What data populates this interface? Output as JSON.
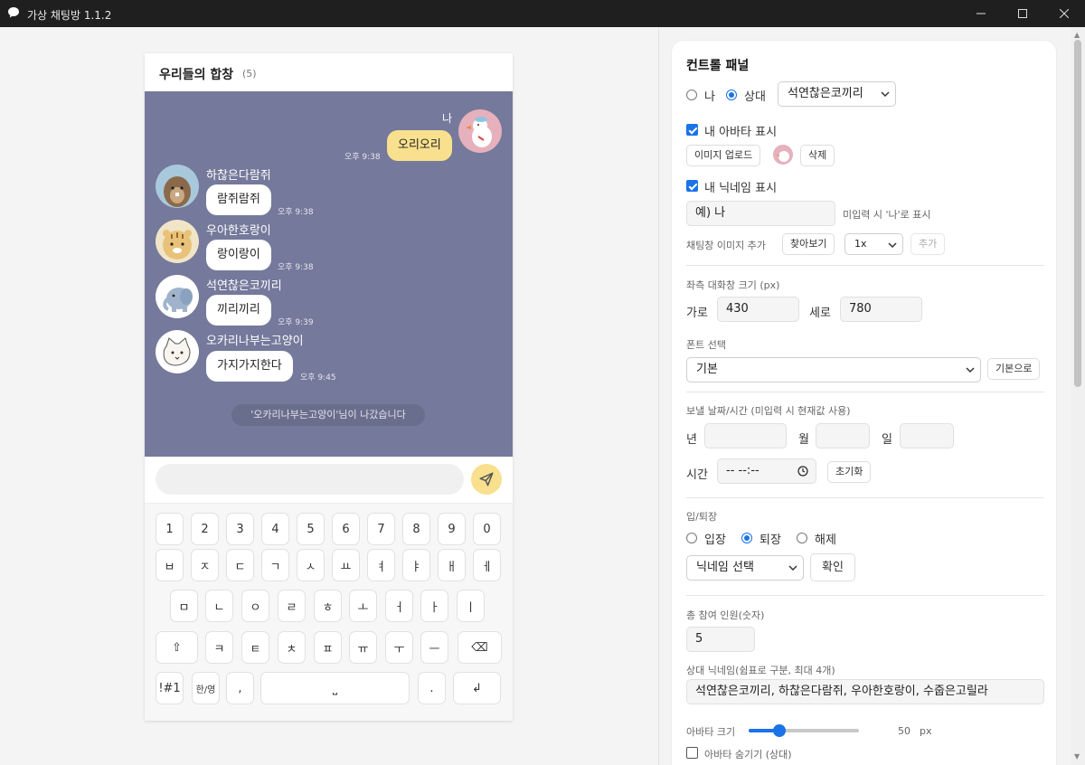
{
  "window": {
    "title": "가상 채팅방 1.1.2"
  },
  "chat": {
    "room_title": "우리들의 합창",
    "member_count": "(5)",
    "me_name": "나",
    "me_message": "오리오리",
    "me_time": "오후 9:38",
    "messages": [
      {
        "name": "하찮은다람쥐",
        "text": "람쥐람쥐",
        "time": "오후 9:38"
      },
      {
        "name": "우아한호랑이",
        "text": "랑이랑이",
        "time": "오후 9:38"
      },
      {
        "name": "석연찮은코끼리",
        "text": "끼리끼리",
        "time": "오후 9:39"
      },
      {
        "name": "오카리나부는고양이",
        "text": "가지가지한다",
        "time": "오후 9:45"
      }
    ],
    "system_message": "'오카리나부는고양이'님이 나갔습니다",
    "input_value": ""
  },
  "keyboard": {
    "row1": [
      "1",
      "2",
      "3",
      "4",
      "5",
      "6",
      "7",
      "8",
      "9",
      "0"
    ],
    "row2": [
      "ㅂ",
      "ㅈ",
      "ㄷ",
      "ㄱ",
      "ㅅ",
      "ㅛ",
      "ㅕ",
      "ㅑ",
      "ㅐ",
      "ㅔ"
    ],
    "row3": [
      "ㅁ",
      "ㄴ",
      "ㅇ",
      "ㄹ",
      "ㅎ",
      "ㅗ",
      "ㅓ",
      "ㅏ",
      "ㅣ"
    ],
    "row4": [
      "⇧",
      "ㅋ",
      "ㅌ",
      "ㅊ",
      "ㅍ",
      "ㅠ",
      "ㅜ",
      "ㅡ",
      "⌫"
    ],
    "row5": [
      "!#1",
      "한/영",
      ",",
      "⎵",
      ".",
      "↲"
    ]
  },
  "panel": {
    "title": "컨트롤 패널",
    "sender_me": "나",
    "sender_other": "상대",
    "sender_selected": "석연찮은코끼리",
    "show_avatar": "내 아바타 표시",
    "upload_image": "이미지 업로드",
    "delete": "삭제",
    "show_nickname": "내 닉네임 표시",
    "nickname_value": "예) 나",
    "nickname_hint": "미입력 시 '나'로 표시",
    "chat_image_label": "채팅창 이미지 추가",
    "browse": "찾아보기",
    "scale_value": "1x",
    "add": "추가",
    "size_label": "좌측 대화창 크기 (px)",
    "width_label": "가로",
    "width_value": "430",
    "height_label": "세로",
    "height_value": "780",
    "font_label": "폰트 선택",
    "font_value": "기본",
    "font_reset": "기본으로",
    "datetime_label": "보낼 날짜/시간 (미입력 시 현재값 사용)",
    "year_label": "년",
    "month_label": "월",
    "day_label": "일",
    "time_label": "시간",
    "time_value": "-- --:--",
    "time_reset": "초기화",
    "entry_label": "입/퇴장",
    "enter": "입장",
    "leave": "퇴장",
    "clear": "해제",
    "nick_select": "닉네임 선택",
    "confirm": "확인",
    "total_label": "총 참여 인원(숫자)",
    "total_value": "5",
    "nicknames_label": "상대 닉네임(쉼표로 구분, 최대 4개)",
    "nicknames_value": "석연찮은코끼리, 하찮은다람쥐, 우아한호랑이, 수줍은고릴라",
    "avatar_size_label": "아바타 크기",
    "avatar_size_value": "50",
    "avatar_size_unit": "px",
    "avatar_size_fraction": 0.28,
    "hide_avatar": "아바타 숨기기 (상대)"
  },
  "colors": {
    "chat_bg": "#75799b",
    "my_bubble": "#f8e08e",
    "accent": "#1a73e8"
  }
}
